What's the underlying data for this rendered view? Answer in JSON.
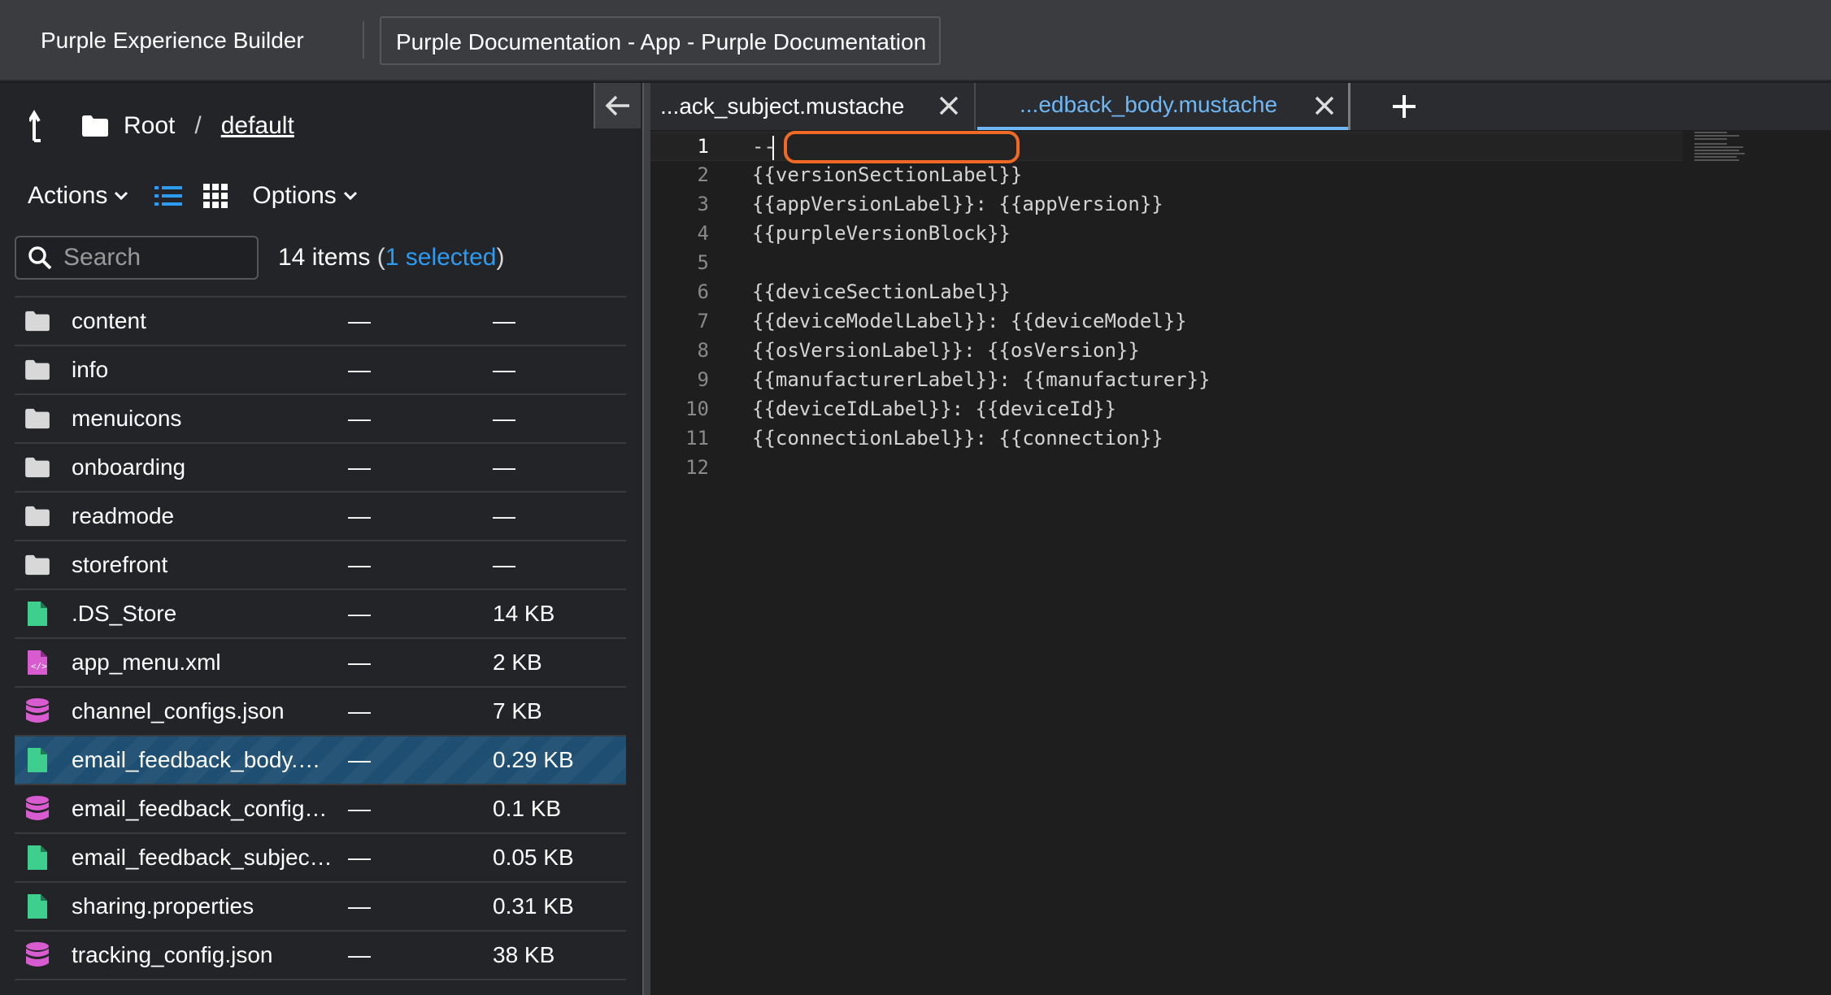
{
  "topbar": {
    "app_title": "Purple Experience Builder",
    "doc_tab": "Purple Documentation - App - Purple Documentation"
  },
  "breadcrumb": {
    "root": "Root",
    "separator": "/",
    "current": "default"
  },
  "toolbar": {
    "actions_label": "Actions",
    "options_label": "Options",
    "view_mode": "list"
  },
  "search": {
    "placeholder": "Search",
    "value": ""
  },
  "count": {
    "items": "14 items",
    "open_paren": "(",
    "selected": "1 selected",
    "close_paren": ")"
  },
  "files": [
    {
      "name": "content",
      "modified": "—",
      "size": "—",
      "icon": "folder-icon",
      "selected": false
    },
    {
      "name": "info",
      "modified": "—",
      "size": "—",
      "icon": "folder-icon",
      "selected": false
    },
    {
      "name": "menuicons",
      "modified": "—",
      "size": "—",
      "icon": "folder-icon",
      "selected": false
    },
    {
      "name": "onboarding",
      "modified": "—",
      "size": "—",
      "icon": "folder-icon",
      "selected": false
    },
    {
      "name": "readmode",
      "modified": "—",
      "size": "—",
      "icon": "folder-icon",
      "selected": false
    },
    {
      "name": "storefront",
      "modified": "—",
      "size": "—",
      "icon": "folder-icon",
      "selected": false
    },
    {
      "name": ".DS_Store",
      "modified": "—",
      "size": "14 KB",
      "icon": "file-icon",
      "selected": false
    },
    {
      "name": "app_menu.xml",
      "modified": "—",
      "size": "2 KB",
      "icon": "code-file-icon",
      "selected": false
    },
    {
      "name": "channel_configs.json",
      "modified": "—",
      "size": "7 KB",
      "icon": "database-icon",
      "selected": false
    },
    {
      "name": "email_feedback_body.…",
      "modified": "—",
      "size": "0.29 KB",
      "icon": "file-icon",
      "selected": true
    },
    {
      "name": "email_feedback_config…",
      "modified": "—",
      "size": "0.1 KB",
      "icon": "database-icon",
      "selected": false
    },
    {
      "name": "email_feedback_subjec…",
      "modified": "—",
      "size": "0.05 KB",
      "icon": "file-icon",
      "selected": false
    },
    {
      "name": "sharing.properties",
      "modified": "—",
      "size": "0.31 KB",
      "icon": "file-icon",
      "selected": false
    },
    {
      "name": "tracking_config.json",
      "modified": "—",
      "size": "38 KB",
      "icon": "database-icon",
      "selected": false
    }
  ],
  "editor": {
    "tabs": [
      {
        "label": "...ack_subject.mustache",
        "active": false
      },
      {
        "label": "...edback_body.mustache",
        "active": true
      }
    ],
    "lines": [
      "--",
      "{{versionSectionLabel}}",
      "{{appVersionLabel}}: {{appVersion}}",
      "{{purpleVersionBlock}}",
      "",
      "{{deviceSectionLabel}}",
      "{{deviceModelLabel}}: {{deviceModel}}",
      "{{osVersionLabel}}: {{osVersion}}",
      "{{manufacturerLabel}}: {{manufacturer}}",
      "{{deviceIdLabel}}: {{deviceId}}",
      "{{connectionLabel}}: {{connection}}",
      ""
    ],
    "current_line": 1
  },
  "colors": {
    "accent": "#2b9cf2",
    "active_tab": "#6fb7f5",
    "highlight": "#f06a25",
    "file_icon": "#3ecf8e",
    "database_icon": "#d95bd0",
    "selected_row": "#1e4f73"
  }
}
